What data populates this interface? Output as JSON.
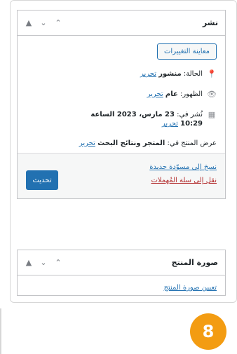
{
  "publish": {
    "title": "نشر",
    "preview_button": "معاينة التغييرات",
    "status_label": "الحالة:",
    "status_value": "منشور",
    "status_edit": "تحرير",
    "visibility_label": "الظهور:",
    "visibility_value": "عام",
    "visibility_edit": "تحرير",
    "published_label": "نُشر في:",
    "published_value": "23 مارس، 2023 الساعة",
    "published_time": "10:29",
    "published_edit": "تحرير",
    "catalog_label": "عرض المنتج في:",
    "catalog_value": "المتجر ونتائج البحث",
    "catalog_edit": "تحرير",
    "copy_draft": "نسخ إلى مسوّدة جديدة",
    "move_trash": "نقل إلى سلة المُهملات",
    "update_button": "تحديث"
  },
  "product_image": {
    "title": "صورة المنتج",
    "set_image": "تعيين صورة المنتج"
  },
  "badge": {
    "number": "8",
    "color": "#f39c12"
  },
  "icons": [
    "chevron-up-icon",
    "chevron-down-icon",
    "triangle-up-icon",
    "pin-icon",
    "eye-icon",
    "calendar-icon"
  ],
  "colors": {
    "accent": "#2271b1",
    "danger": "#b32d2e"
  }
}
